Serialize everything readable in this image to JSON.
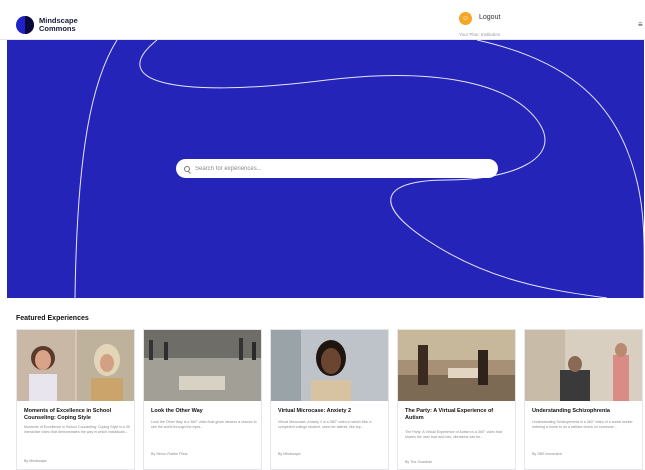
{
  "brand": {
    "name_line1": "Mindscape",
    "name_line2": "Commons"
  },
  "user": {
    "avatar_initial": "☺",
    "logout_label": "Logout",
    "institution": "Your Plan: Institution"
  },
  "nav": {
    "menu_icon": "menu-icon"
  },
  "colors": {
    "hero_bg": "#2424b8",
    "accent": "#f5a623",
    "card_border": "#e6e6ea"
  },
  "search": {
    "placeholder": "Search for experiences..."
  },
  "featured": {
    "title": "Featured Experiences",
    "cards": [
      {
        "title": "Moments of Excellence in School Counseling: Coping Style",
        "description": "Moments of Excellence in School Counseling: Coping Style is a 30 interactive video that demonstrates the way in which individuals...",
        "author": "By Mindscape"
      },
      {
        "title": "Look the Other Way",
        "description": "Look the Other Way is a 360° video that gives viewers a chance to see the world through the eyes...",
        "author": "By Simon Robbe Films"
      },
      {
        "title": "Virtual Microcase: Anxiety 2",
        "description": "Virtual Microcase: Anxiety 2 is a 360° video in which Mia, a competent college student, uses her talents, like top...",
        "author": "By Mindscape"
      },
      {
        "title": "The Party: A Virtual Experience of Autism",
        "description": "The Party: A Virtual Experience of Autism is a 360° video that shares the user how and lots, vibrations can be...",
        "author": "By The Guardian"
      },
      {
        "title": "Understanding Schizophrenia",
        "description": "Understanding Schizophrenia is a 360° video of a social worker entering a home to do a welfare check on someone...",
        "author": "By SBS Immersive"
      }
    ]
  }
}
